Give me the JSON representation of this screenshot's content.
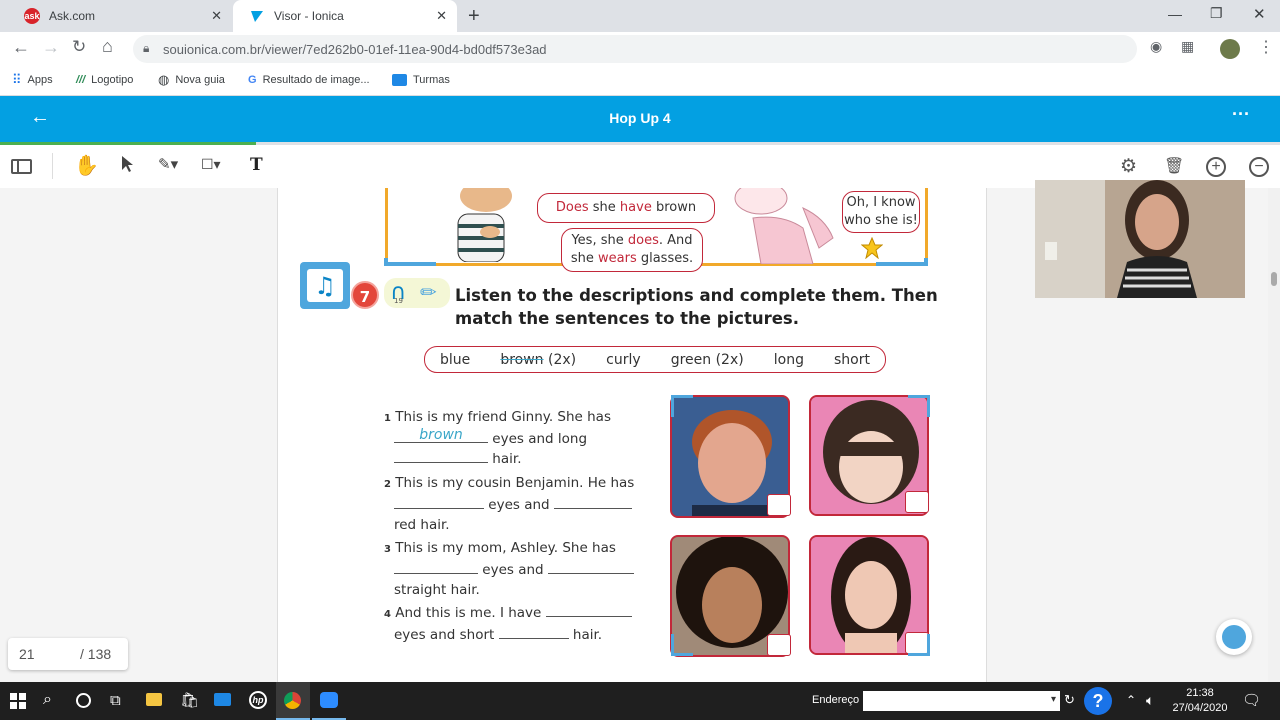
{
  "browser": {
    "tabs": [
      {
        "title": "Ask.com",
        "active": false
      },
      {
        "title": "Visor - Ionica",
        "active": true
      }
    ],
    "url": "souionica.com.br/viewer/7ed262b0-01ef-11ea-90d4-bd0df573e3ad",
    "bookmarks": [
      "Apps",
      "Logotipo",
      "Nova guia",
      "Resultado de image...",
      "Turmas"
    ]
  },
  "app": {
    "title": "Hop Up 4"
  },
  "pagination": {
    "current": "21",
    "total": "/ 138"
  },
  "book": {
    "bubbles": {
      "q_pre": "Does",
      "q_mid": " she ",
      "q_have": "have",
      "q_post": " brown hair?",
      "a_pre": "Yes, she ",
      "a_does": "does",
      "a_mid": ". And",
      "a_line2_pre": "she ",
      "a_wears": "wears",
      "a_post": " glasses.",
      "know_1": "Oh, I know",
      "know_2": "who she is!"
    },
    "activity_number": "7",
    "audio_track": "19",
    "instruction_1": "Listen to the descriptions and complete them. Then",
    "instruction_2": "match the sentences to the pictures.",
    "words": [
      "blue",
      "brown",
      "(2x)",
      "curly",
      "green (2x)",
      "long",
      "short"
    ],
    "exercises": {
      "e1_num": "1",
      "e1_l1": "This is my friend Ginny. She has",
      "e1_answer": "brown",
      "e1_l2": "eyes and long",
      "e1_l3": "hair.",
      "e2_num": "2",
      "e2_l1": "This is my cousin Benjamin. He has",
      "e2_l2": "eyes and",
      "e2_l3": "red hair.",
      "e3_num": "3",
      "e3_l1": "This is my mom, Ashley. She has",
      "e3_l2": "eyes and",
      "e3_l3": "straight hair.",
      "e4_num": "4",
      "e4_l1": "And this is me. I have",
      "e4_l2": "eyes and short",
      "e4_l3": "hair."
    }
  },
  "taskbar": {
    "address_label": "Endereço",
    "time": "21:38",
    "date": "27/04/2020"
  },
  "colors": {
    "appbar": "#03a0e2",
    "book_red": "#c2283a",
    "answer_blue": "#3aa6c8"
  }
}
